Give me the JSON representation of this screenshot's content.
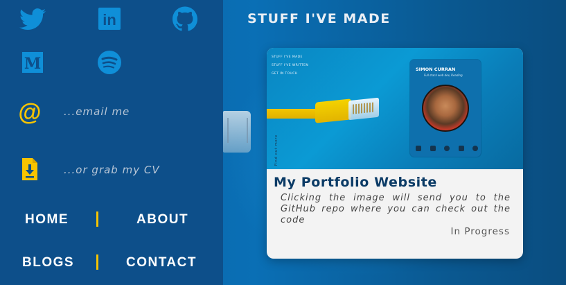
{
  "sidebar": {
    "social": [
      {
        "name": "twitter"
      },
      {
        "name": "linkedin",
        "text": "in"
      },
      {
        "name": "github"
      },
      {
        "name": "medium",
        "text": "M"
      },
      {
        "name": "spotify"
      }
    ],
    "email_label": "...email me",
    "cv_label": "...or grab my CV",
    "email_glyph": "@",
    "nav": {
      "home": "HOME",
      "about": "ABOUT",
      "blogs": "BLOGS",
      "contact": "CONTACT"
    }
  },
  "main": {
    "section_title": "STUFF I'VE MADE",
    "project": {
      "title": "My Portfolio Website",
      "description": "Clicking the image will send you to the GitHub repo where you can check out the code",
      "status": "In Progress",
      "thumbnail": {
        "nav_items": [
          "STUFF I'VE MADE",
          "STUFF I'VE WRITTEN",
          "GET IN TOUCH"
        ],
        "vertical_text": "Find out more",
        "profile_name": "SIMON CURRAN",
        "profile_subtitle": "Full stack web dev, Reading"
      }
    }
  },
  "colors": {
    "accent_yellow": "#f7c400",
    "sidebar_bg": "#0d4f8a",
    "title_blue": "#0b3b66"
  }
}
